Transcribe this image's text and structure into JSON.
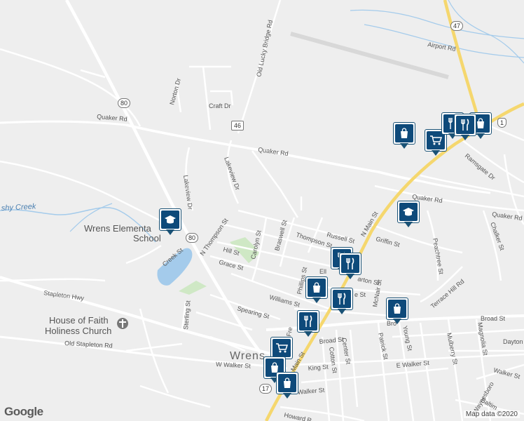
{
  "map": {
    "town": "Wrens",
    "places": {
      "school": "Wrens Elementary School",
      "school_line1": "Wrens Elementa",
      "school_line2": "School",
      "church_line1": "House of Faith",
      "church_line2": "Holiness Church"
    },
    "water": {
      "creek": "shy Creek"
    },
    "roads": {
      "old_lucky_bridge": "Old Lucky Bridge Rd",
      "airport": "Airport Rd",
      "norton": "Norton Dr",
      "craft": "Craft Dr",
      "quaker_left": "Quaker Rd",
      "quaker_mid": "Quaker Rd",
      "quaker_right": "Quaker Rd",
      "quaker_far": "Quaker Rd",
      "lakeview": "Lakeview Dr",
      "lakeview_lower": "Lakeview Dr",
      "n_main": "N Main St",
      "main": "Main St",
      "ramsgate": "Ramsgate Dr",
      "russell": "Russell St",
      "thompson": "Thompson St",
      "n_thompson": "N Thompson St",
      "braswell": "Braswell St",
      "carolyn": "Carolyn St",
      "griffin": "Griffin St",
      "peachtree": "Peachtree St",
      "chalker": "Chalker St",
      "terrace_hill": "Terrace Hill Rd",
      "hill": "Hill St",
      "grace": "Grace St",
      "creek": "Creek St",
      "stapleton": "Stapleton Hwy",
      "old_stapleton": "Old Stapleton Rd",
      "sterling": "Sterling St",
      "spearing": "Spearing St",
      "williams": "Williams St",
      "phillips": "Phillips St",
      "mcnair": "McNair St",
      "broad": "Broad St",
      "broad_left": "Broad St",
      "dayton": "Dayton S",
      "magnolia": "Magnolia St",
      "mulberry": "Mulberry St",
      "young": "Young St",
      "patrick": "Patrick St",
      "center": "Center St",
      "cotton": "Cotton St",
      "king": "King St",
      "e_walker": "E Walker St",
      "w_walker": "W Walker St",
      "walker_right": "Walker St",
      "walker_left": "Walker St",
      "waynesboro": "Waynesboro",
      "howard": "Howard R",
      "baltimore": "Baltim",
      "free": "Fre",
      "ella": "Ell",
      "arton": "arton St",
      "e_st": "e St",
      "bro": "Bro"
    },
    "shields": {
      "us1": "1",
      "ga47": "47",
      "ga46": "46",
      "ga80a": "80",
      "ga80b": "80",
      "ga17": "17"
    },
    "markers": [
      {
        "type": "shopping",
        "icon": "shopping-bag-icon"
      },
      {
        "type": "grocery",
        "icon": "shopping-cart-icon"
      },
      {
        "type": "restaurant",
        "icon": "fork-knife-icon"
      },
      {
        "type": "restaurant",
        "icon": "fork-knife-icon"
      },
      {
        "type": "shopping",
        "icon": "shopping-bag-icon"
      },
      {
        "type": "school",
        "icon": "graduation-cap-icon"
      },
      {
        "type": "school",
        "icon": "graduation-cap-icon"
      },
      {
        "type": "restaurant",
        "icon": "fork-knife-icon"
      },
      {
        "type": "restaurant",
        "icon": "fork-knife-icon"
      },
      {
        "type": "shopping",
        "icon": "shopping-bag-icon"
      },
      {
        "type": "restaurant",
        "icon": "fork-knife-icon"
      },
      {
        "type": "shopping",
        "icon": "shopping-bag-icon"
      },
      {
        "type": "restaurant",
        "icon": "fork-knife-icon"
      },
      {
        "type": "grocery",
        "icon": "shopping-cart-icon"
      },
      {
        "type": "shopping",
        "icon": "shopping-bag-icon"
      },
      {
        "type": "shopping",
        "icon": "shopping-bag-icon"
      }
    ],
    "colors": {
      "background": "#eeeeee",
      "highway": "#f5d76e",
      "water": "#a4cbeb",
      "park": "#cfe8c5",
      "marker": "#0e4a7a"
    }
  },
  "attribution": {
    "logo": "Google",
    "copyright": "Map data ©2020"
  }
}
